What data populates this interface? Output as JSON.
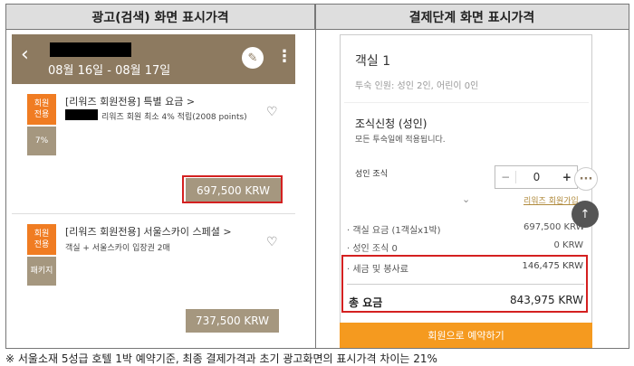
{
  "headers": {
    "left": "광고(검색) 화면 표시가격",
    "right": "결제단계 화면 표시가격"
  },
  "left": {
    "appbar": {
      "back_icon": "‹",
      "dates": "08월 16일 - 08월 17일",
      "edit_icon": "✎",
      "more_icon": "⋮"
    },
    "items": [
      {
        "badge_top": "회원\n전용",
        "badge_bottom": "7%",
        "title": "[리워즈 회원전용] 특별 요금 >",
        "subtitle": "리워즈 회원 최소 4% 적립(2008 points)",
        "price": "697,500 KRW"
      },
      {
        "badge_top": "회원\n전용",
        "badge_bottom": "패키지",
        "title": "[리워즈 회원전용] 서울스카이 스페셜 >",
        "subtitle": "객실 + 서울스카이 입장권 2매",
        "price": "737,500 KRW"
      }
    ]
  },
  "right": {
    "room": "객실 1",
    "guests": "투숙 인원: 성인 2인, 어린이 0인",
    "breakfast": "조식신청 (성인)",
    "breakfast_note": "모든 투숙일에 적용됩니다.",
    "adult_breakfast": "성인 조식",
    "qty": "0",
    "minus": "−",
    "plus": "+",
    "rewards_link": "리워즈 회원가입",
    "rows": [
      {
        "label": "· 객실 요금 (1객실x1박)",
        "value": "697,500 KRW"
      },
      {
        "label": "· 성인 조식 0",
        "value": "0 KRW"
      },
      {
        "label": "· 세금 및 봉사료",
        "value": "146,475 KRW"
      }
    ],
    "total_label": "총 요금",
    "total_value": "843,975 KRW",
    "book_button": "회원으로 예약하기"
  },
  "note": "※ 서울소재 5성급 호텔 1박 예약기준, 최종 결제가격과 초기 광고화면의 표시가격 차이는 21%"
}
